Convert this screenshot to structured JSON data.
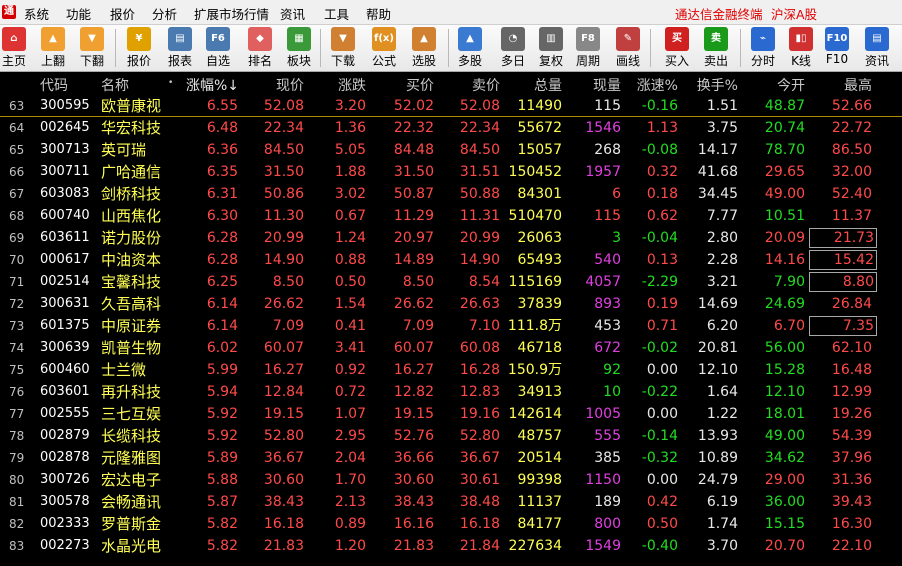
{
  "menu": {
    "items": [
      "系统",
      "功能",
      "报价",
      "分析",
      "扩展市场行情",
      "资讯",
      "工具",
      "帮助"
    ],
    "brand": "通达信金融终端",
    "market": "沪深A股"
  },
  "toolbar": {
    "buttons": [
      "主页",
      "上翻",
      "下翻",
      "报价",
      "报表",
      "自选",
      "排名",
      "板块",
      "下载",
      "公式",
      "选股",
      "多股",
      "多日",
      "复权",
      "周期",
      "画线",
      "买入",
      "卖出",
      "分时",
      "K线",
      "F10",
      "资讯"
    ],
    "icons": [
      "home-icon",
      "page-up-icon",
      "page-down-icon",
      "quote-icon",
      "report-icon",
      "favorites-icon",
      "ranking-icon",
      "sector-icon",
      "download-icon",
      "formula-icon",
      "stock-picker-icon",
      "multi-stock-icon",
      "multi-day-icon",
      "adjust-icon",
      "period-icon",
      "draw-line-icon",
      "buy-icon",
      "sell-icon",
      "intraday-icon",
      "kline-icon",
      "f10-icon",
      "news-icon"
    ],
    "icon_glyphs": [
      "⌂",
      "▲",
      "▼",
      "¥",
      "▤",
      "F6",
      "◆",
      "▦",
      "▼",
      "f(x)",
      "▲",
      "▲",
      "◔",
      "▥",
      "F8",
      "✎",
      "买",
      "卖",
      "⌁",
      "▮▯",
      "F10",
      "▤"
    ]
  },
  "table": {
    "headers": [
      "代码",
      "名称",
      "•",
      "涨幅%↓",
      "现价",
      "涨跌",
      "买价",
      "卖价",
      "总量",
      "现量",
      "涨速%",
      "换手%",
      "今开",
      "最高"
    ],
    "rows": [
      [
        "63",
        "300595",
        "欧普康视",
        "6.55",
        "52.08",
        "3.20",
        "52.02",
        "52.08",
        "11490",
        "115",
        "-0.16",
        "1.51",
        "48.87",
        "52.66"
      ],
      [
        "64",
        "002645",
        "华宏科技",
        "6.48",
        "22.34",
        "1.36",
        "22.32",
        "22.34",
        "55672",
        "1546",
        "1.13",
        "3.75",
        "20.74",
        "22.72"
      ],
      [
        "65",
        "300713",
        "英可瑞",
        "6.36",
        "84.50",
        "5.05",
        "84.48",
        "84.50",
        "15057",
        "268",
        "-0.08",
        "14.17",
        "78.70",
        "86.50"
      ],
      [
        "66",
        "300711",
        "广哈通信",
        "6.35",
        "31.50",
        "1.88",
        "31.50",
        "31.51",
        "150452",
        "1957",
        "0.32",
        "41.68",
        "29.65",
        "32.00"
      ],
      [
        "67",
        "603083",
        "剑桥科技",
        "6.31",
        "50.86",
        "3.02",
        "50.87",
        "50.88",
        "84301",
        "6",
        "0.18",
        "34.45",
        "49.00",
        "52.40"
      ],
      [
        "68",
        "600740",
        "山西焦化",
        "6.30",
        "11.30",
        "0.67",
        "11.29",
        "11.31",
        "510470",
        "115",
        "0.62",
        "7.77",
        "10.51",
        "11.37"
      ],
      [
        "69",
        "603611",
        "诺力股份",
        "6.28",
        "20.99",
        "1.24",
        "20.97",
        "20.99",
        "26063",
        "3",
        "-0.04",
        "2.80",
        "20.09",
        "21.73"
      ],
      [
        "70",
        "000617",
        "中油资本",
        "6.28",
        "14.90",
        "0.88",
        "14.89",
        "14.90",
        "65493",
        "540",
        "0.13",
        "2.28",
        "14.16",
        "15.42"
      ],
      [
        "71",
        "002514",
        "宝馨科技",
        "6.25",
        "8.50",
        "0.50",
        "8.50",
        "8.54",
        "115169",
        "4057",
        "-2.29",
        "3.21",
        "7.90",
        "8.80"
      ],
      [
        "72",
        "300631",
        "久吾高科",
        "6.14",
        "26.62",
        "1.54",
        "26.62",
        "26.63",
        "37839",
        "893",
        "0.19",
        "14.69",
        "24.69",
        "26.84"
      ],
      [
        "73",
        "601375",
        "中原证券",
        "6.14",
        "7.09",
        "0.41",
        "7.09",
        "7.10",
        "111.8万",
        "453",
        "0.71",
        "6.20",
        "6.70",
        "7.35"
      ],
      [
        "74",
        "300639",
        "凯普生物",
        "6.02",
        "60.07",
        "3.41",
        "60.07",
        "60.08",
        "46718",
        "672",
        "-0.02",
        "20.81",
        "56.00",
        "62.10"
      ],
      [
        "75",
        "600460",
        "士兰微",
        "5.99",
        "16.27",
        "0.92",
        "16.27",
        "16.28",
        "150.9万",
        "92",
        "0.00",
        "12.10",
        "15.28",
        "16.48"
      ],
      [
        "76",
        "603601",
        "再升科技",
        "5.94",
        "12.84",
        "0.72",
        "12.82",
        "12.83",
        "34913",
        "10",
        "-0.22",
        "1.64",
        "12.10",
        "12.99"
      ],
      [
        "77",
        "002555",
        "三七互娱",
        "5.92",
        "19.15",
        "1.07",
        "19.15",
        "19.16",
        "142614",
        "1005",
        "0.00",
        "1.22",
        "18.01",
        "19.26"
      ],
      [
        "78",
        "002879",
        "长缆科技",
        "5.92",
        "52.80",
        "2.95",
        "52.76",
        "52.80",
        "48757",
        "555",
        "-0.14",
        "13.93",
        "49.00",
        "54.39"
      ],
      [
        "79",
        "002878",
        "元隆雅图",
        "5.89",
        "36.67",
        "2.04",
        "36.66",
        "36.67",
        "20514",
        "385",
        "-0.32",
        "10.89",
        "34.62",
        "37.96"
      ],
      [
        "80",
        "300726",
        "宏达电子",
        "5.88",
        "30.60",
        "1.70",
        "30.60",
        "30.61",
        "99398",
        "1150",
        "0.00",
        "24.79",
        "29.00",
        "31.36"
      ],
      [
        "81",
        "300578",
        "会畅通讯",
        "5.87",
        "38.43",
        "2.13",
        "38.43",
        "38.48",
        "11137",
        "189",
        "0.42",
        "6.19",
        "36.00",
        "39.43"
      ],
      [
        "82",
        "002333",
        "罗普斯金",
        "5.82",
        "16.18",
        "0.89",
        "16.16",
        "16.18",
        "84177",
        "800",
        "0.50",
        "1.74",
        "15.15",
        "16.30"
      ],
      [
        "83",
        "002273",
        "水晶光电",
        "5.82",
        "21.83",
        "1.20",
        "21.83",
        "21.84",
        "227634",
        "1549",
        "-0.40",
        "3.70",
        "20.70",
        "22.10"
      ]
    ],
    "colors": {
      "up": "#ff4a4a",
      "down": "#22dd22",
      "flat": "#e8e8e8",
      "name": "#ffff55",
      "volume": "#ffff55",
      "large_lot": "#e040e0"
    }
  }
}
